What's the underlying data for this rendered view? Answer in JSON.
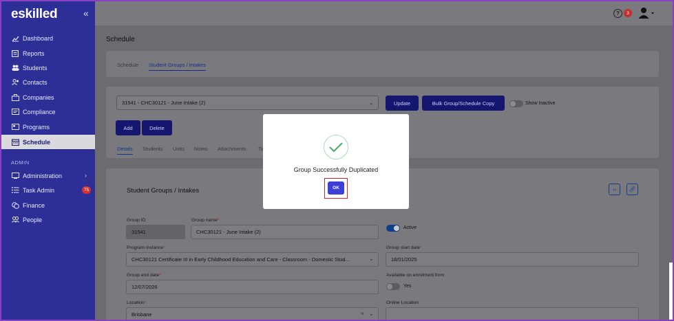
{
  "brand": {
    "logo": "eskilled",
    "collapse": "«"
  },
  "sidebar": {
    "items": [
      {
        "label": "Dashboard",
        "icon": "chart-line-icon"
      },
      {
        "label": "Reports",
        "icon": "report-icon"
      },
      {
        "label": "Students",
        "icon": "users-icon"
      },
      {
        "label": "Contacts",
        "icon": "contacts-icon"
      },
      {
        "label": "Companies",
        "icon": "companies-icon"
      },
      {
        "label": "Compliance",
        "icon": "compliance-icon"
      },
      {
        "label": "Programs",
        "icon": "programs-icon"
      },
      {
        "label": "Schedule",
        "icon": "calendar-icon"
      }
    ],
    "admin_section": "ADMIN",
    "admin_items": [
      {
        "label": "Administration",
        "icon": "admin-icon"
      },
      {
        "label": "Task Admin",
        "icon": "list-icon",
        "badge": "75"
      },
      {
        "label": "Finance",
        "icon": "coins-icon"
      },
      {
        "label": "People",
        "icon": "people-icon"
      }
    ]
  },
  "topbar": {
    "help": "?",
    "help_badge": "3"
  },
  "page": {
    "title": "Schedule",
    "tabs": [
      "Schedule",
      "Student Groups / Intakes"
    ]
  },
  "group_selector": {
    "selected": "31541 - CHC30121 - June Intake (2)",
    "update_label": "Update",
    "bulk_copy_label": "Bulk Group/Schedule Copy",
    "show_inactive_label": "Show Inactive",
    "add_label": "Add",
    "delete_label": "Delete",
    "sub_tabs": [
      "Details",
      "Students",
      "Units",
      "Notes",
      "Attachments",
      "Ta"
    ]
  },
  "details": {
    "section_title": "Student Groups / Intakes",
    "group_id_label": "Group ID",
    "group_id": "31541",
    "group_name_label": "Group name",
    "group_name": "CHC30121 - June Intake (2)",
    "active_label": "Active",
    "program_instance_label": "Program instance",
    "program_instance": "CHC30121 Certificate III in Early Childhood Education and Care - Classroom - Domestic Stud...",
    "start_date_label": "Group start date",
    "start_date": "18/01/2025",
    "end_date_label": "Group end date",
    "end_date": "12/07/2026",
    "enrolment_label": "Available on enrolment form",
    "enrolment_value": "Yes",
    "location_label": "Location",
    "location": "Brisbane",
    "online_location_label": "Online Location"
  },
  "modal": {
    "message": "Group Successfully Duplicated",
    "ok_label": "OK"
  }
}
